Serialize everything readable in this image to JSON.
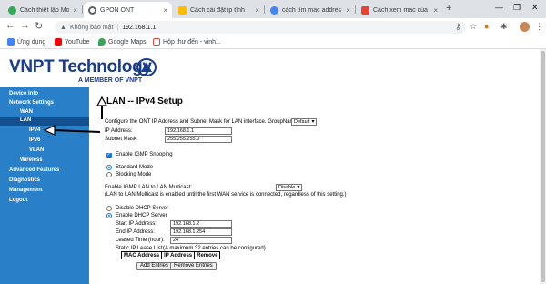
{
  "browser": {
    "tabs": [
      {
        "title": "Cách thiết lập Modem",
        "active": false,
        "favicon_color": "#34a853"
      },
      {
        "title": "GPON ONT",
        "active": true,
        "favicon_color": "#5f6368"
      },
      {
        "title": "Cách cài đặt ip tĩnh",
        "active": false,
        "favicon_color": "#fbbc04"
      },
      {
        "title": "cách tìm mac addres",
        "active": false,
        "favicon_color": "#4285f4"
      },
      {
        "title": "Cách xem mac của",
        "active": false,
        "favicon_color": "#ea4335"
      }
    ],
    "new_tab": "+",
    "security_label": "Không bảo mật",
    "url": "192.168.1.1",
    "bookmarks": [
      {
        "label": "Ứng dụng",
        "icon": "apps-icon",
        "color": "#4285f4"
      },
      {
        "label": "YouTube",
        "icon": "youtube-icon",
        "color": "#ff0000"
      },
      {
        "label": "Google Maps",
        "icon": "maps-icon",
        "color": "#34a853"
      },
      {
        "label": "Hộp thư đến - vinh...",
        "icon": "gmail-icon",
        "color": "#ea4335"
      }
    ]
  },
  "brand": {
    "name": "VNPT Technology",
    "tagline": "A MEMBER OF VNPT",
    "color": "#1a3c8f"
  },
  "sidebar": {
    "color": "#2a80c8",
    "selected_color": "#12508f",
    "items": [
      {
        "label": "Device Info"
      },
      {
        "label": "Network Settings"
      },
      {
        "label": "WAN"
      },
      {
        "label": "LAN"
      },
      {
        "label": "IPv4"
      },
      {
        "label": "IPv6"
      },
      {
        "label": "VLAN"
      },
      {
        "label": "Wireless"
      },
      {
        "label": "Advanced Features"
      },
      {
        "label": "Diagnostics"
      },
      {
        "label": "Management"
      },
      {
        "label": "Logout"
      }
    ]
  },
  "main": {
    "title": "LAN -- IPv4 Setup",
    "intro": "Configure the ONT IP Address and Subnet Mask for LAN interface.  GroupName",
    "group_name": "Default",
    "ip_label": "IP Address:",
    "ip_value": "192.168.1.1",
    "mask_label": "Subnet Mask:",
    "mask_value": "255.255.255.0",
    "igmp_snooping_label": "Enable IGMP Snooping",
    "standard_mode_label": "Standard Mode",
    "blocking_mode_label": "Blocking Mode",
    "multicast_label": "Enable IGMP LAN to LAN Multicast:",
    "multicast_value": "Disable",
    "multicast_note": "(LAN to LAN Multicast is enabled until the first WAN service is connected, regardless of this setting.)",
    "disable_dhcp_label": "Disable DHCP Server",
    "enable_dhcp_label": "Enable DHCP Server",
    "start_ip_label": "Start IP Address:",
    "start_ip_value": "192.168.1.2",
    "end_ip_label": "End IP Address:",
    "end_ip_value": "192.168.1.254",
    "lease_label": "Leased Time (hour):",
    "lease_value": "24",
    "static_list_label": "Static IP Lease List:",
    "static_list_note": "(A maximum 32 entries can be configured)",
    "table_headers": [
      "MAC Address",
      "IP Address",
      "Remove"
    ],
    "add_entries": "Add Entries",
    "remove_entries": "Remove Entries"
  }
}
